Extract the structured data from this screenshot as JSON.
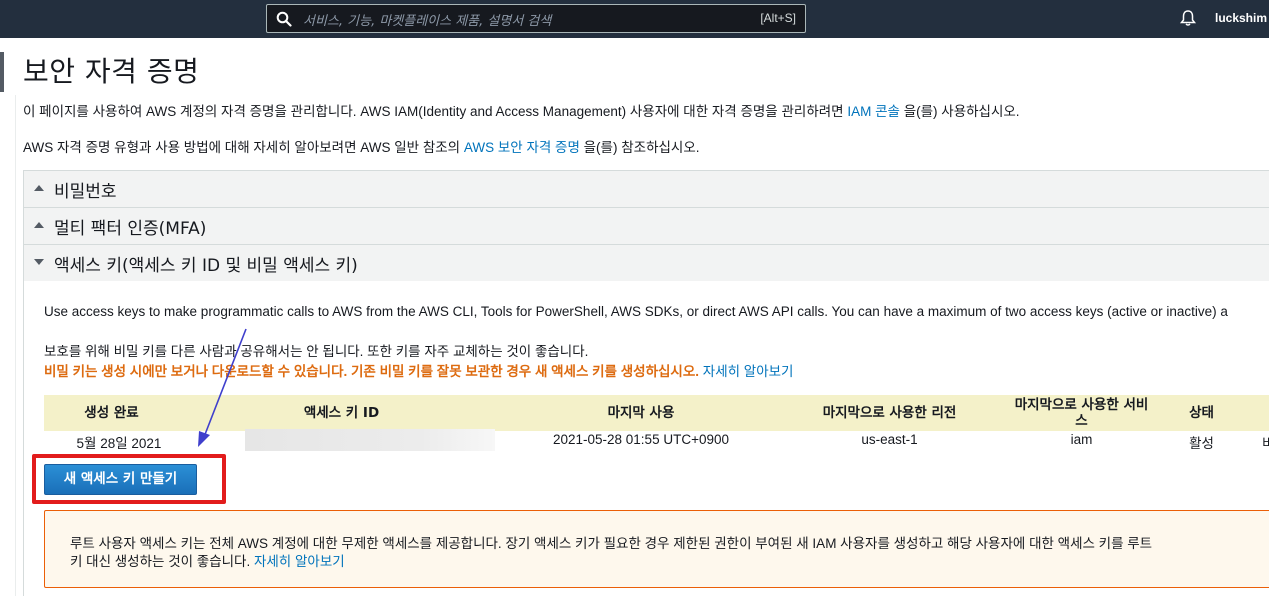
{
  "nav": {
    "search_placeholder": "서비스, 기능, 마켓플레이스 제품, 설명서 검색",
    "search_shortcut": "[Alt+S]",
    "username": "luckshim",
    "icons": [
      "search-icon",
      "bell-icon"
    ]
  },
  "page": {
    "title": "보안 자격 증명",
    "intro_line1_pre": "이 페이지를 사용하여 AWS 계정의 자격 증명을 관리합니다. AWS IAM(Identity and Access Management) 사용자에 대한 자격 증명을 관리하려면 ",
    "intro_line1_link": "IAM 콘솔",
    "intro_line1_post": " 을(를) 사용하십시오.",
    "intro_line2_pre": "AWS 자격 증명 유형과 사용 방법에 대해 자세히 알아보려면 AWS 일반 참조의 ",
    "intro_line2_link": "AWS 보안 자격 증명",
    "intro_line2_post": " 을(를) 참조하십시오."
  },
  "accordion": {
    "password": "비밀번호",
    "mfa": "멀티 팩터 인증(MFA)",
    "access_keys": "액세스 키(액세스 키 ID 및 비밀 액세스 키)"
  },
  "access_keys": {
    "desc_en": "Use access keys to make programmatic calls to AWS from the AWS CLI, Tools for PowerShell, AWS SDKs, or direct AWS API calls. You can have a maximum of two access keys (active or inactive) a",
    "desc_ko": "보호를 위해 비밀 키를 다른 사람과 공유해서는 안 됩니다. 또한 키를 자주 교체하는 것이 좋습니다.",
    "warning": "비밀 키는 생성 시에만 보거나 다운로드할 수 있습니다. 기존 비밀 키를 잘못 보관한 경우 새 액세스 키를 생성하십시오.",
    "learn_more": "자세히 알아보기",
    "columns": [
      "생성 완료",
      "액세스 키 ID",
      "마지막 사용",
      "마지막으로 사용한 리전",
      "마지막으로 사용한 서비스",
      "상태"
    ],
    "rows": [
      {
        "created": "5월 28일 2021",
        "key_id": "",
        "last_used": "2021-05-28 01:55 UTC+0900",
        "region": "us-east-1",
        "service": "iam",
        "status": "활성",
        "action_partial": "비"
      }
    ],
    "create_button": "새 액세스 키 만들기"
  },
  "alert": {
    "line1": "루트 사용자 액세스 키는 전체 AWS 계정에 대한 무제한 액세스를 제공합니다. 장기 액세스 키가 필요한 경우 제한된 권한이 부여된 새 IAM 사용자를 생성하고 해당 사용자에 대한 액세스 키를 루트",
    "line2_pre": "키 대신 생성하는 것이 좋습니다. ",
    "line2_link": "자세히 알아보기"
  },
  "colors": {
    "nav_bg": "#232f3e",
    "link": "#0073bb",
    "warning_orange": "#dd6b10",
    "table_header_bg": "#f4f1c9",
    "button_blue": "#1a6fb8",
    "highlight_red": "#e21c1c",
    "annotation_arrow": "#3f3fcc"
  }
}
